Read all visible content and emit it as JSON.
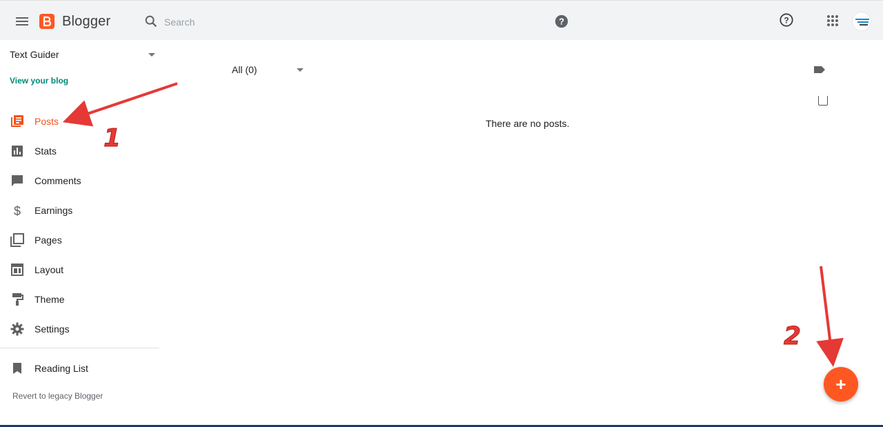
{
  "header": {
    "app_name": "Blogger",
    "search_placeholder": "Search",
    "brand_color": "#ff5722"
  },
  "sidebar": {
    "blog_name": "Text Guider",
    "view_blog_label": "View your blog",
    "items": [
      {
        "label": "Posts",
        "icon": "posts-icon",
        "active": true
      },
      {
        "label": "Stats",
        "icon": "stats-icon"
      },
      {
        "label": "Comments",
        "icon": "comments-icon"
      },
      {
        "label": "Earnings",
        "icon": "earnings-icon"
      },
      {
        "label": "Pages",
        "icon": "pages-icon"
      },
      {
        "label": "Layout",
        "icon": "layout-icon"
      },
      {
        "label": "Theme",
        "icon": "theme-icon"
      },
      {
        "label": "Settings",
        "icon": "settings-icon"
      }
    ],
    "reading_list_label": "Reading List",
    "revert_label": "Revert to legacy Blogger"
  },
  "main": {
    "filter_label": "All (0)",
    "empty_message": "There are no posts.",
    "fab_label": "+"
  },
  "annotations": {
    "step1": "1",
    "step2": "2",
    "color": "#e53935"
  }
}
